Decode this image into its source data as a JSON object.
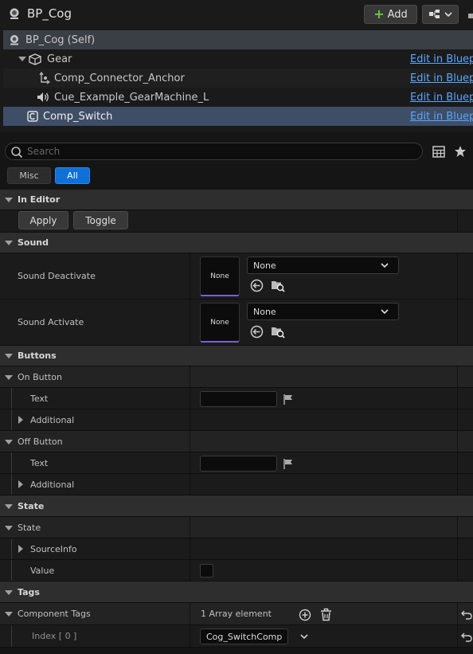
{
  "header": {
    "title": "BP_Cog",
    "add_label": "Add"
  },
  "tree": {
    "self": "BP_Cog (Self)",
    "items": [
      {
        "label": "Gear",
        "link": "Edit in Blueprint"
      },
      {
        "label": "Comp_Connector_Anchor",
        "link": "Edit in Blueprint"
      },
      {
        "label": "Cue_Example_GearMachine_L",
        "link": "Edit in Blueprint"
      },
      {
        "label": "Comp_Switch",
        "link": "Edit in Blueprint"
      }
    ]
  },
  "search": {
    "placeholder": "Search"
  },
  "filters": {
    "misc": "Misc",
    "all": "All"
  },
  "sections": {
    "in_editor": "In Editor",
    "apply": "Apply",
    "toggle": "Toggle",
    "sound": "Sound",
    "sound_deactivate": "Sound Deactivate",
    "sound_activate": "Sound Activate",
    "thumb_none": "None",
    "select_none": "None",
    "buttons": "Buttons",
    "on_button": "On Button",
    "off_button": "Off Button",
    "text": "Text",
    "additional": "Additional",
    "state": "State",
    "state_sub": "State",
    "source_info": "SourceInfo",
    "value": "Value",
    "tags": "Tags",
    "component_tags": "Component Tags",
    "array_count": "1 Array element",
    "index0": "Index [ 0 ]",
    "tag_value": "Cog_SwitchComp"
  },
  "colors": {
    "accent": "#0f70d6",
    "link": "#5aa7ff",
    "selection": "#3e4e66",
    "thumb_border": "#7a5fd6",
    "add_plus": "#6dc93a"
  }
}
